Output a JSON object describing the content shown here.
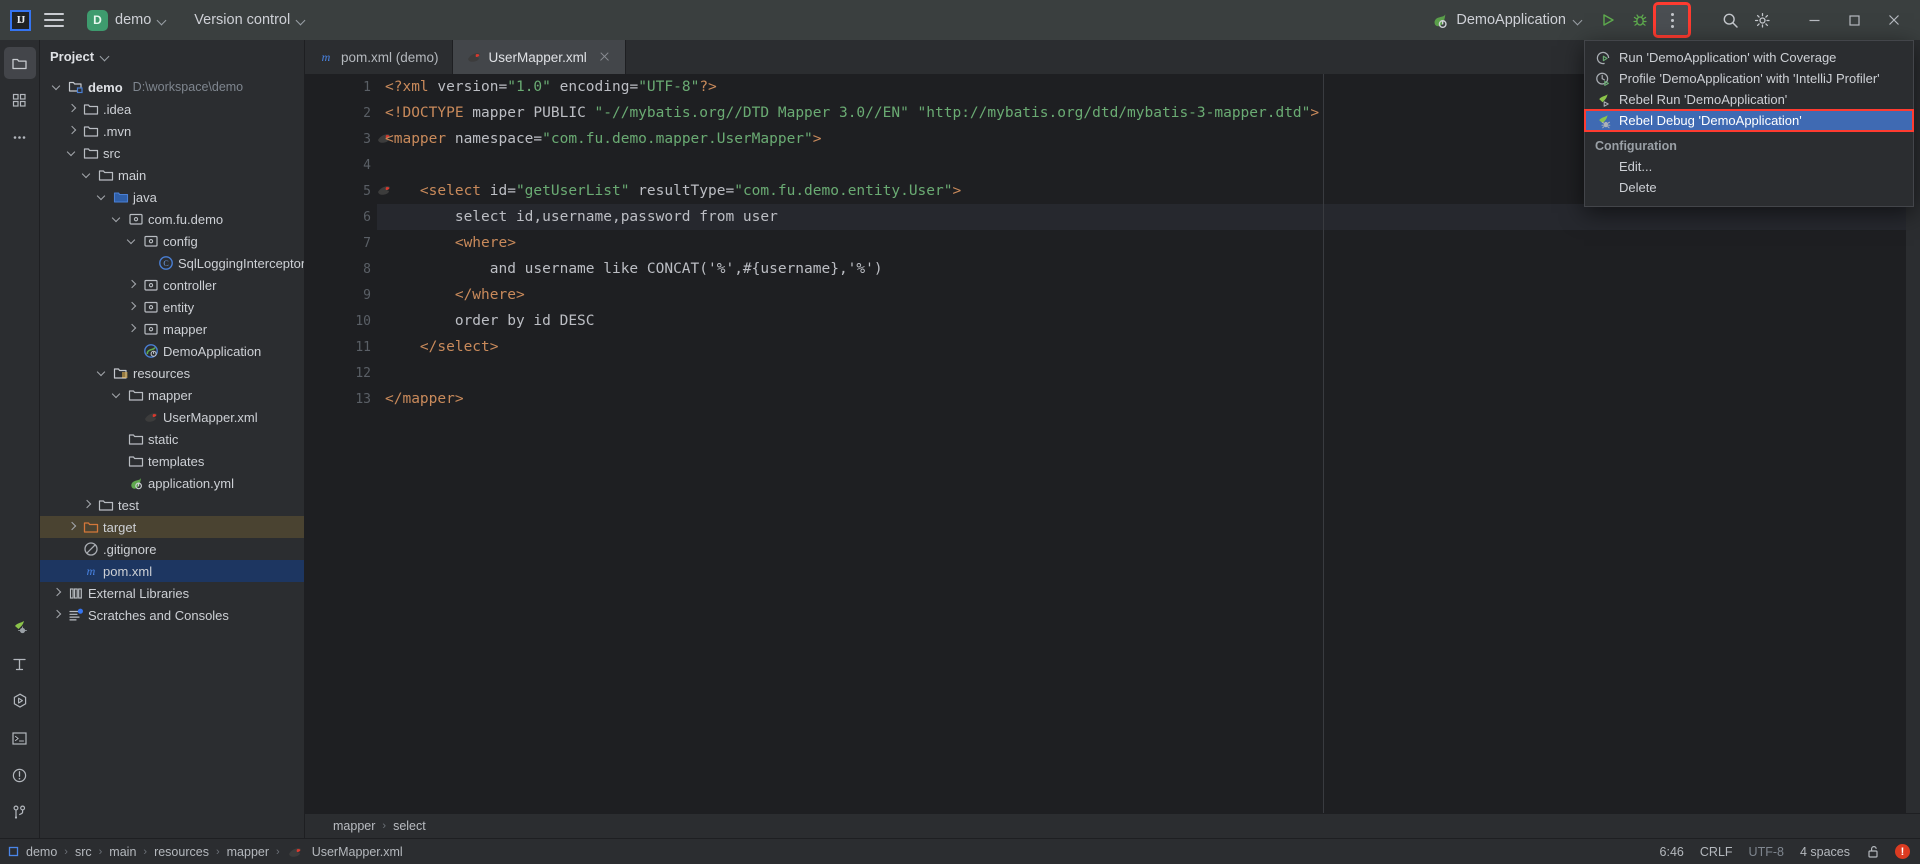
{
  "titlebar": {
    "logo_text": "IJ",
    "menu_icon": "hamburger-icon",
    "project_badge": "D",
    "project_name": "demo",
    "vcs_label": "Version control",
    "run_config_name": "DemoApplication",
    "run_icon": "run-icon",
    "debug_icon": "debug-icon",
    "more_icon": "more-vertical-icon",
    "search_icon": "search-icon",
    "settings_icon": "gear-icon",
    "minimize_icon": "minimize-icon",
    "maximize_icon": "maximize-icon",
    "close_icon": "close-icon"
  },
  "menu": {
    "items": [
      {
        "label": "Run 'DemoApplication' with Coverage",
        "icon": "run-with-coverage-icon",
        "selected": false
      },
      {
        "label": "Profile 'DemoApplication' with 'IntelliJ Profiler'",
        "icon": "profiler-icon",
        "selected": false
      },
      {
        "label": "Rebel Run 'DemoApplication'",
        "icon": "jrebel-run-icon",
        "selected": false
      },
      {
        "label": "Rebel Debug 'DemoApplication'",
        "icon": "jrebel-debug-icon",
        "selected": true
      }
    ],
    "section_label": "Configuration",
    "config_items": [
      {
        "label": "Edit..."
      },
      {
        "label": "Delete"
      }
    ]
  },
  "toolstrip": {
    "top": [
      {
        "name": "project-tool-icon",
        "active": true
      },
      {
        "name": "commit-tool-icon",
        "active": false
      },
      {
        "name": "more-tools-icon",
        "active": false
      }
    ],
    "bottom": [
      {
        "name": "jrebel-tool-icon"
      },
      {
        "name": "structure-tool-icon"
      },
      {
        "name": "run-tool-icon"
      },
      {
        "name": "terminal-tool-icon"
      },
      {
        "name": "problems-tool-icon"
      },
      {
        "name": "version-control-tool-icon"
      }
    ]
  },
  "project_panel": {
    "title": "Project",
    "tree": [
      {
        "depth": 0,
        "arrow": "down",
        "icon": "module-folder-icon",
        "label": "demo",
        "bold": true,
        "path": "D:\\workspace\\demo"
      },
      {
        "depth": 1,
        "arrow": "right",
        "icon": "folder-icon",
        "label": ".idea"
      },
      {
        "depth": 1,
        "arrow": "right",
        "icon": "folder-icon",
        "label": ".mvn"
      },
      {
        "depth": 1,
        "arrow": "down",
        "icon": "folder-icon",
        "label": "src"
      },
      {
        "depth": 2,
        "arrow": "down",
        "icon": "folder-icon",
        "label": "main"
      },
      {
        "depth": 3,
        "arrow": "down",
        "icon": "source-folder-icon",
        "label": "java"
      },
      {
        "depth": 4,
        "arrow": "down",
        "icon": "package-icon",
        "label": "com.fu.demo"
      },
      {
        "depth": 5,
        "arrow": "down",
        "icon": "package-icon",
        "label": "config"
      },
      {
        "depth": 6,
        "arrow": "none",
        "icon": "java-class-icon",
        "label": "SqlLoggingInterceptor"
      },
      {
        "depth": 5,
        "arrow": "right",
        "icon": "package-icon",
        "label": "controller"
      },
      {
        "depth": 5,
        "arrow": "right",
        "icon": "package-icon",
        "label": "entity"
      },
      {
        "depth": 5,
        "arrow": "right",
        "icon": "package-icon",
        "label": "mapper"
      },
      {
        "depth": 5,
        "arrow": "none",
        "icon": "spring-boot-class-icon",
        "label": "DemoApplication"
      },
      {
        "depth": 3,
        "arrow": "down",
        "icon": "resource-folder-icon",
        "label": "resources"
      },
      {
        "depth": 4,
        "arrow": "down",
        "icon": "folder-icon",
        "label": "mapper"
      },
      {
        "depth": 5,
        "arrow": "none",
        "icon": "mybatis-file-icon",
        "label": "UserMapper.xml"
      },
      {
        "depth": 4,
        "arrow": "none",
        "icon": "folder-icon",
        "label": "static"
      },
      {
        "depth": 4,
        "arrow": "none",
        "icon": "folder-icon",
        "label": "templates"
      },
      {
        "depth": 4,
        "arrow": "none",
        "icon": "spring-yaml-icon",
        "label": "application.yml"
      },
      {
        "depth": 2,
        "arrow": "right",
        "icon": "folder-icon",
        "label": "test"
      },
      {
        "depth": 1,
        "arrow": "right",
        "icon": "excluded-folder-icon",
        "label": "target",
        "highlight": "target"
      },
      {
        "depth": 1,
        "arrow": "none",
        "icon": "gitignore-icon",
        "label": ".gitignore"
      },
      {
        "depth": 1,
        "arrow": "none",
        "icon": "maven-file-icon",
        "label": "pom.xml",
        "highlight": "selected"
      },
      {
        "depth": 0,
        "arrow": "right",
        "icon": "library-icon",
        "label": "External Libraries"
      },
      {
        "depth": 0,
        "arrow": "right",
        "icon": "scratches-icon",
        "label": "Scratches and Consoles"
      }
    ]
  },
  "editor": {
    "tabs": [
      {
        "label": "pom.xml (demo)",
        "icon": "maven-file-icon",
        "active": false,
        "closable": false
      },
      {
        "label": "UserMapper.xml",
        "icon": "mybatis-file-icon",
        "active": true,
        "closable": true
      }
    ],
    "current_line": 6,
    "lines": [
      {
        "n": 1,
        "gutter_icon": "none",
        "text": "<?xml version=\"1.0\" encoding=\"UTF-8\"?>"
      },
      {
        "n": 2,
        "gutter_icon": "none",
        "text": "<!DOCTYPE mapper PUBLIC \"-//mybatis.org//DTD Mapper 3.0//EN\" \"http://mybatis.org/dtd/mybatis-3-mapper.dtd\">"
      },
      {
        "n": 3,
        "gutter_icon": "mybatis",
        "text": "<mapper namespace=\"com.fu.demo.mapper.UserMapper\">"
      },
      {
        "n": 4,
        "gutter_icon": "none",
        "text": ""
      },
      {
        "n": 5,
        "gutter_icon": "mybatis",
        "text": "    <select id=\"getUserList\" resultType=\"com.fu.demo.entity.User\">"
      },
      {
        "n": 6,
        "gutter_icon": "none",
        "text": "        select id,username,password from user"
      },
      {
        "n": 7,
        "gutter_icon": "none",
        "text": "        <where>"
      },
      {
        "n": 8,
        "gutter_icon": "none",
        "text": "            and username like CONCAT('%',#{username},'%')"
      },
      {
        "n": 9,
        "gutter_icon": "none",
        "text": "        </where>"
      },
      {
        "n": 10,
        "gutter_icon": "none",
        "text": "        order by id DESC"
      },
      {
        "n": 11,
        "gutter_icon": "none",
        "text": "    </select>"
      },
      {
        "n": 12,
        "gutter_icon": "none",
        "text": ""
      },
      {
        "n": 13,
        "gutter_icon": "none",
        "text": "</mapper>"
      }
    ],
    "breadcrumb": [
      "mapper",
      "select"
    ]
  },
  "statusbar": {
    "breadcrumb": [
      "demo",
      "src",
      "main",
      "resources",
      "mapper",
      "UserMapper.xml"
    ],
    "file_icon": "mybatis-file-icon",
    "caret": "6:46",
    "line_separator": "CRLF",
    "encoding": "UTF-8",
    "indent": "4 spaces",
    "lock_icon": "unlocked-icon",
    "error_badge": "!"
  },
  "colors": {
    "accent_blue": "#3574f0",
    "selection_blue": "#3f6ab3",
    "highlight_red": "#ff3b30",
    "spring_green": "#6aab73",
    "tag_orange": "#c98a5b"
  }
}
